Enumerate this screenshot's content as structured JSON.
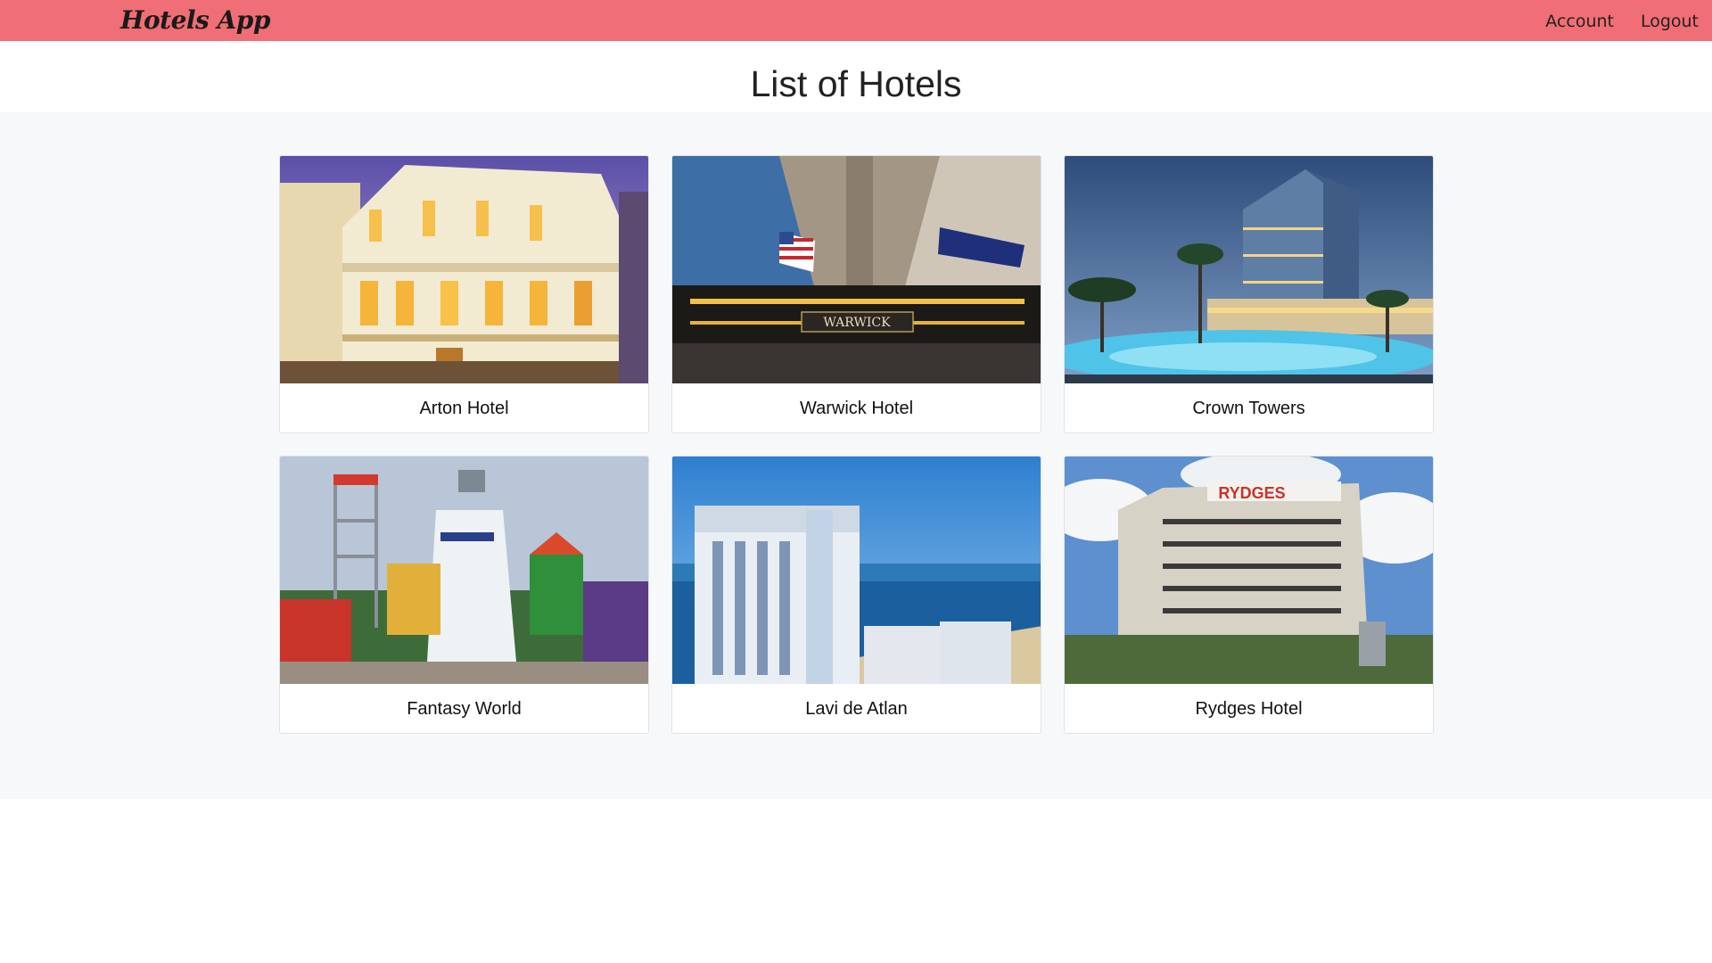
{
  "navbar": {
    "brand": "Hotels App",
    "links": [
      {
        "label": "Account"
      },
      {
        "label": "Logout"
      }
    ]
  },
  "page": {
    "title": "List of Hotels"
  },
  "hotels": [
    {
      "name": "Arton Hotel"
    },
    {
      "name": "Warwick Hotel"
    },
    {
      "name": "Crown Towers"
    },
    {
      "name": "Fantasy World"
    },
    {
      "name": "Lavi de Atlan"
    },
    {
      "name": "Rydges Hotel"
    }
  ],
  "image_lettering": {
    "warwick_sign": "WARWICK",
    "rydges_sign": "RYDGES"
  },
  "colors": {
    "navbar": "#f06e75",
    "page_background": "#f7f8fa",
    "card_background": "#ffffff"
  }
}
